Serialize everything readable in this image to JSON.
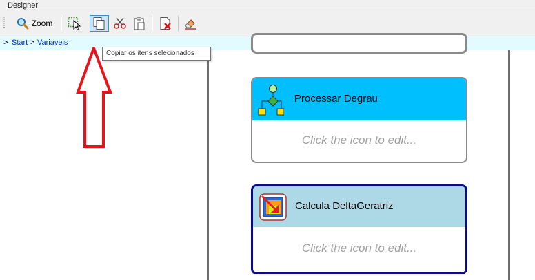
{
  "panel": {
    "title": "Designer"
  },
  "toolbar": {
    "zoom_label": "Zoom",
    "buttons": [
      "zoom-icon",
      "select-icon",
      "copy-icon",
      "cut-icon",
      "paste-icon",
      "delete-icon",
      "eraser-icon"
    ]
  },
  "breadcrumb": {
    "items": [
      {
        "sep": ">",
        "label": "Start"
      },
      {
        "sep": ">",
        "label": "Variaveis"
      }
    ]
  },
  "tooltip": {
    "text": "Copiar os itens selecionados"
  },
  "activities": [
    {
      "title": "Processar Degrau",
      "hint": "Click the icon to edit...",
      "header_color": "#00bfff",
      "border_color": "#8a8a8a",
      "icon": "flowchart-icon"
    },
    {
      "title": "Calcula DeltaGeratriz",
      "hint": "Click the icon to edit...",
      "header_color": "#add8e6",
      "border_color": "#0a0a8a",
      "icon": "custom-activity-icon"
    }
  ],
  "colors": {
    "annotation_arrow": "#e8141c",
    "breadcrumb_bg": "#e2fbff",
    "toolbar_bg": "#f0f0f0"
  }
}
